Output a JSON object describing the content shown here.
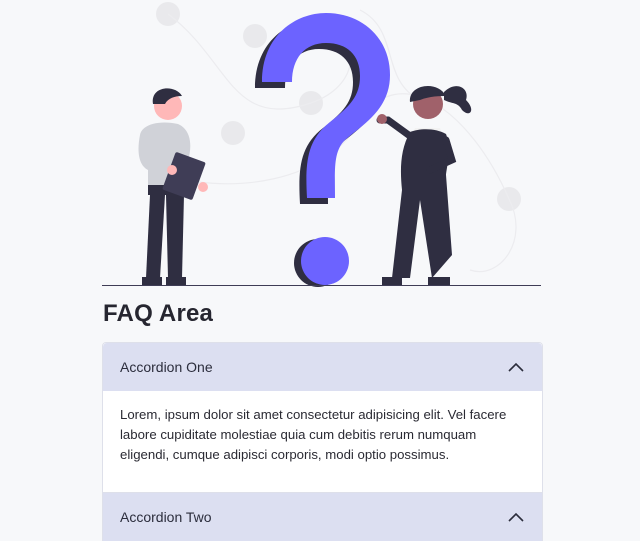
{
  "faq": {
    "title": "FAQ Area"
  },
  "accordion": {
    "items": [
      {
        "label": "Accordion One",
        "expanded": true,
        "body": "Lorem, ipsum dolor sit amet consectetur adipisicing elit. Vel facere labore cupiditate molestiae quia cum debitis rerum numquam eligendi, cumque adipisci corporis, modi optio possimus."
      },
      {
        "label": "Accordion Two",
        "expanded": true
      }
    ]
  },
  "colors": {
    "accent": "#6c63ff",
    "header_bg": "#dcdff1",
    "dark": "#2f2e41"
  }
}
